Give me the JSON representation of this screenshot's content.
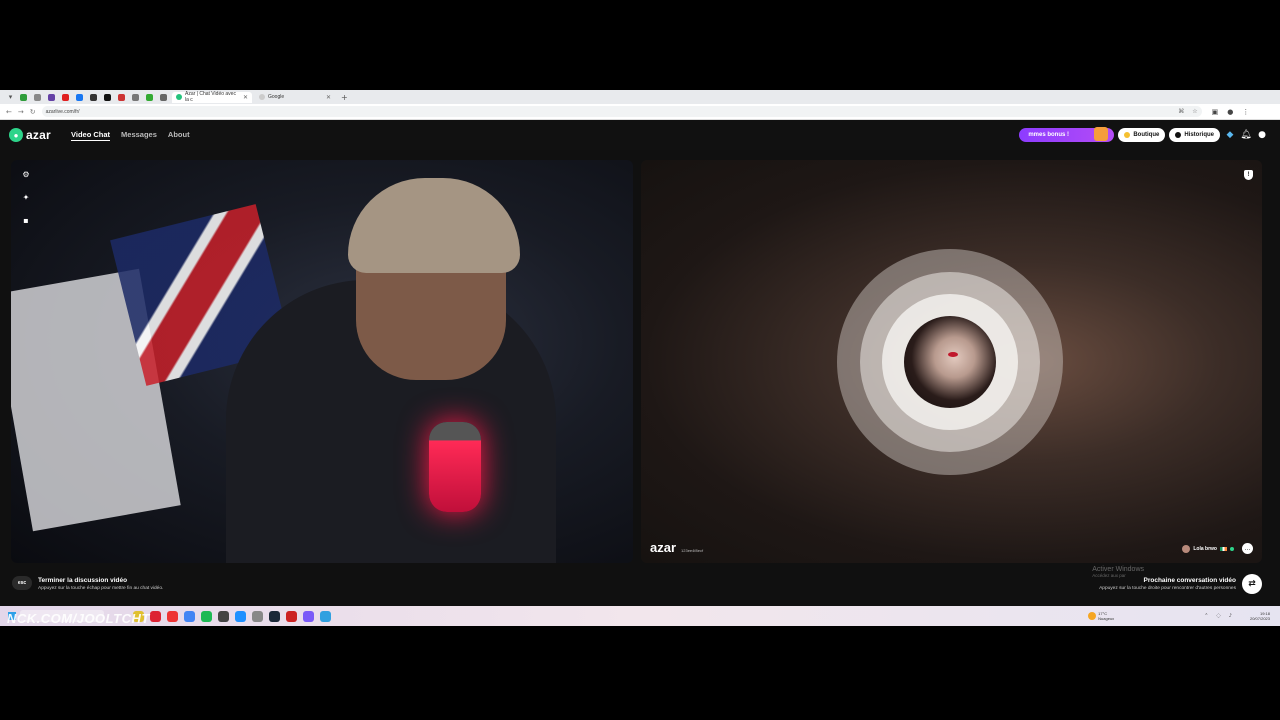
{
  "browser": {
    "tabs": [
      {
        "label": "Azar | Chat Vidéo avec la c",
        "active": true
      },
      {
        "label": "Google",
        "active": false
      }
    ],
    "url": "azarlive.com/fr/"
  },
  "header": {
    "logo_text": "azar",
    "nav": [
      {
        "label": "Video Chat",
        "active": true
      },
      {
        "label": "Messages",
        "active": false
      },
      {
        "label": "About",
        "active": false
      }
    ],
    "promo_label": "mmes bonus !",
    "shop_label": "Boutique",
    "history_label": "Historique"
  },
  "remote": {
    "watermark": "azar",
    "watermark_id": "123ee4f8ecf",
    "partner_name": "Lola brwo"
  },
  "footer": {
    "esc_key": "esc",
    "end_title": "Terminer la discussion vidéo",
    "end_hint": "Appuyez sur la touche échap pour mettre fin au chat vidéo.",
    "next_title": "Prochaine conversation vidéo",
    "next_hint": "Appuyez sur la touche droite pour rencontrer d'autres personnes",
    "activate_title": "Activer Windows",
    "activate_hint": "Accédez aux par"
  },
  "taskbar": {
    "weather_temp": "17°C",
    "weather_desc": "Nuageux",
    "time": "19:18",
    "date": "20/07/2023"
  },
  "overlay_text": "NCK.COM/JOOLTCHT",
  "colors": {
    "brand_green": "#2dd48a",
    "promo_purple": "#8d3cff",
    "mic_red": "#ff2a56"
  }
}
